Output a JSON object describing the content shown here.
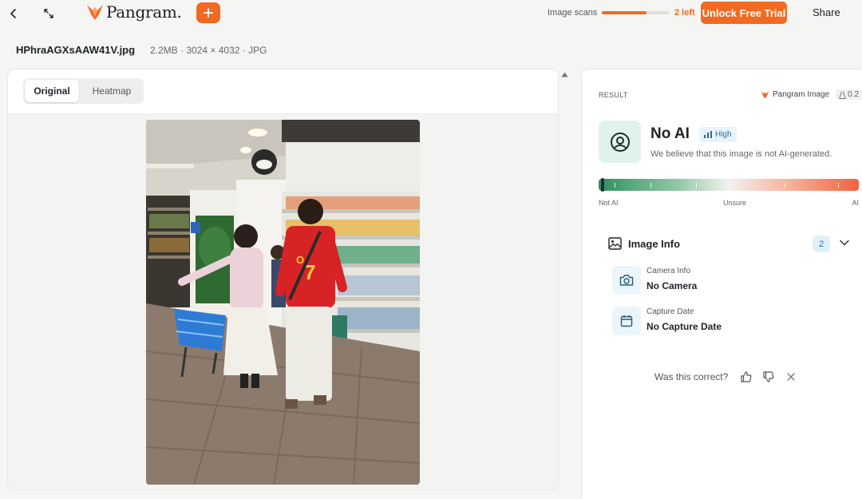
{
  "brand": {
    "name": "Pangram.",
    "color": "#f26a21"
  },
  "topbar": {
    "back_icon": "chevron-left-icon",
    "expand_icon": "expand-icon",
    "new_scan_icon": "plus-icon",
    "scans_label": "Image scans",
    "scans_used_fraction": 0.67,
    "scans_left": "2 left",
    "unlock_label": "Unlock Free Trial",
    "share_label": "Share"
  },
  "file": {
    "name": "HPhraAGXsAAW41V.jpg",
    "meta": "2.2MB · 3024 × 4032 · JPG"
  },
  "tabs": [
    {
      "label": "Original",
      "active": true
    },
    {
      "label": "Heatmap",
      "active": false
    }
  ],
  "result": {
    "section_label": "RESULT",
    "model_name": "Pangram Image",
    "model_version": "0.2",
    "verdict": "No AI",
    "confidence": "High",
    "description": "We believe that this image is not AI-generated.",
    "score_fraction": 0.015,
    "scale": {
      "left": "Not AI",
      "middle": "Unsure",
      "right": "AI"
    },
    "colors": {
      "not_ai": "#2f8f5e",
      "ai": "#f0623d",
      "verdict_bg": "#dff3ea"
    }
  },
  "image_info": {
    "title": "Image Info",
    "count": "2",
    "items": [
      {
        "icon": "camera-icon",
        "label": "Camera Info",
        "value": "No Camera"
      },
      {
        "icon": "calendar-icon",
        "label": "Capture Date",
        "value": "No Capture Date"
      }
    ]
  },
  "feedback": {
    "question": "Was this correct?"
  }
}
